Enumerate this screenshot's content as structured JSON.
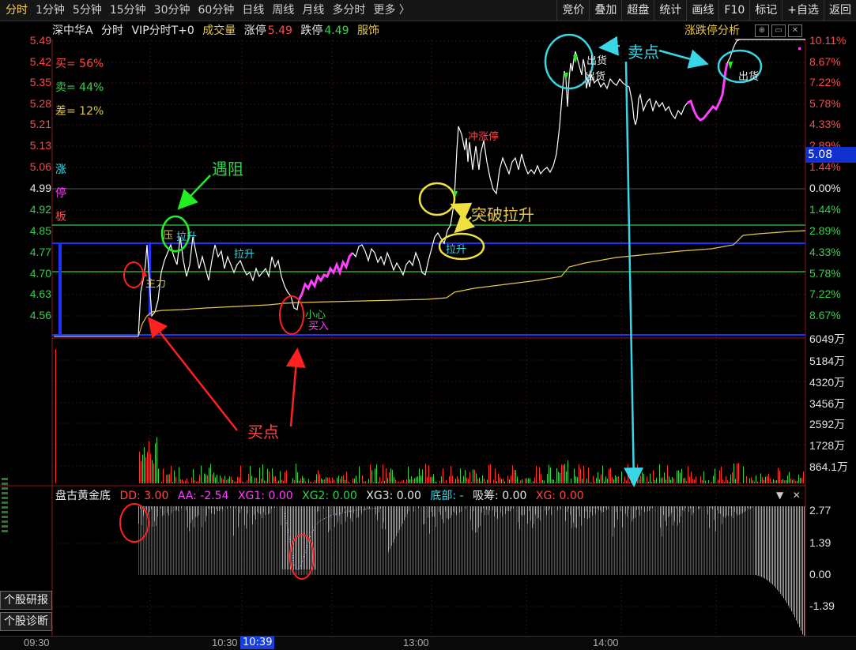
{
  "toolbar": {
    "periods": [
      "分时",
      "1分钟",
      "5分钟",
      "15分钟",
      "30分钟",
      "60分钟",
      "日线",
      "周线",
      "月线",
      "多分时",
      "更多 〉"
    ],
    "actions": [
      "竞价",
      "叠加",
      "超盘",
      "统计",
      "画线",
      "F10",
      "标记",
      "+自选",
      "返回"
    ]
  },
  "info": {
    "stock": "深中华A",
    "mode": "分时",
    "vip": "VIP分时T+0",
    "volume": "成交量",
    "limit_up_label": "涨停",
    "limit_up_value": "5.49",
    "limit_down_label": "跌停",
    "limit_down_value": "4.49",
    "sector": "服饰",
    "analysis": "涨跌停分析"
  },
  "stats": {
    "buy": "买= 56%",
    "sell": "卖= 44%",
    "diff": "差= 12%"
  },
  "side_chars": [
    "涨",
    "停",
    "板"
  ],
  "price_axis": [
    "5.49",
    "5.42",
    "5.35",
    "5.28",
    "5.21",
    "5.13",
    "5.06",
    "4.99",
    "4.92",
    "4.85",
    "4.77",
    "4.70",
    "4.63",
    "4.56"
  ],
  "pct_axis": [
    "10.11%",
    "8.67%",
    "7.22%",
    "5.78%",
    "4.33%",
    "2.89%",
    "1.44%",
    "0.00%",
    "1.44%",
    "2.89%",
    "4.33%",
    "5.78%",
    "7.22%",
    "8.67%"
  ],
  "volume_axis": [
    "6049万",
    "5184万",
    "4320万",
    "3456万",
    "2592万",
    "1728万",
    "864.1万"
  ],
  "current_price": "5.08",
  "indicator": {
    "name": "盘古黄金底",
    "dd": "DD: 3.00",
    "aa": "AA: -2.54",
    "xg1": "XG1: 0.00",
    "xg2": "XG2: 0.00",
    "xg3": "XG3: 0.00",
    "bottom": "底部: -",
    "absorb": "吸筹: 0.00",
    "xg": "XG: 0.00",
    "axis": [
      "2.77",
      "1.39",
      "0.00",
      "-1.39"
    ]
  },
  "side_buttons": [
    "个股研报",
    "个股诊断"
  ],
  "time_axis": [
    "09:30",
    "10:30",
    "13:00",
    "14:00"
  ],
  "time_cursor": "10:39",
  "annotations": {
    "small": [
      "主力",
      "拉升",
      "拉升",
      "小心",
      "买入",
      "拉升",
      "冲涨停",
      "出货",
      "出货",
      "出货"
    ],
    "yuzu": "遇阻",
    "tupo": "突破拉升",
    "maidian_buy": "买点",
    "maidian_sell": "卖点",
    "ya": "压"
  },
  "colors": {
    "up": "#ff4848",
    "down": "#32d24a",
    "price_line": "#ffffff",
    "avg_line": "#e6c84a",
    "highlight": "#ff40ff",
    "cyan": "#3ad6e6"
  }
}
